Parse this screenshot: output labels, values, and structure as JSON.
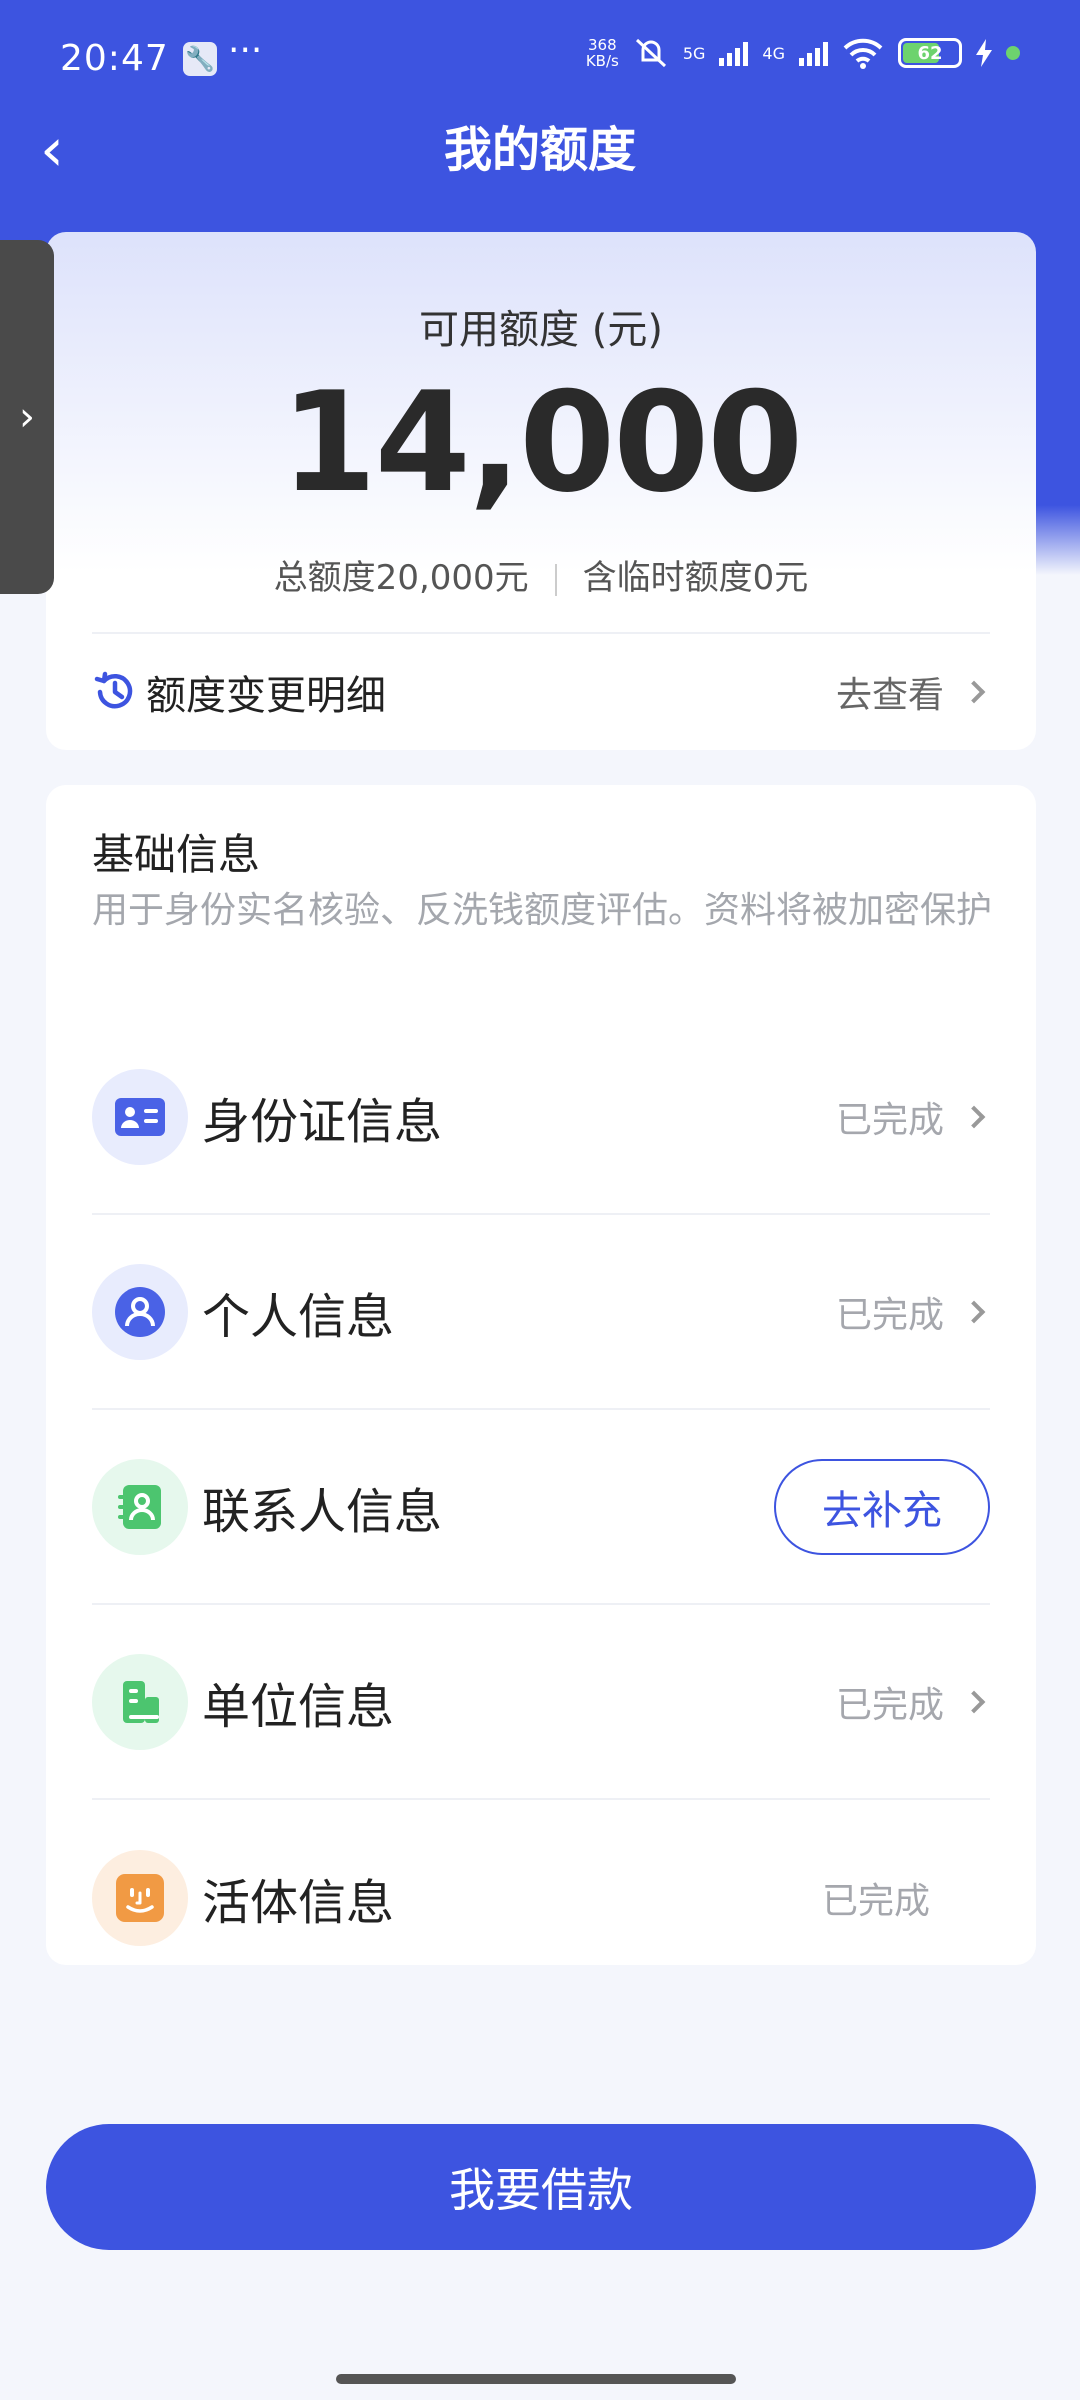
{
  "status_bar": {
    "time": "20:47",
    "more": "···",
    "net_speed_value": "368",
    "net_speed_unit": "KB/s",
    "sim1": "5G",
    "sim2": "4G",
    "battery": "62"
  },
  "header": {
    "back": "‹",
    "title": "我的额度"
  },
  "side_tab": {
    "arrow": "›"
  },
  "credit": {
    "available_label": "可用额度 (元)",
    "available_amount": "14,000",
    "total_limit": "总额度20,000元",
    "temp_limit": "含临时额度0元",
    "history_label": "额度变更明细",
    "history_link": "去查看"
  },
  "basic_info": {
    "title": "基础信息",
    "description": "用于身份实名核验、反洗钱额度评估。资料将被加密保护",
    "items": [
      {
        "label": "身份证信息",
        "status": "已完成",
        "icon": "id-card-icon"
      },
      {
        "label": "个人信息",
        "status": "已完成",
        "icon": "person-icon"
      },
      {
        "label": "联系人信息",
        "action": "去补充",
        "icon": "contact-icon"
      },
      {
        "label": "单位信息",
        "status": "已完成",
        "icon": "building-icon"
      },
      {
        "label": "活体信息",
        "status": "已完成",
        "icon": "face-icon"
      }
    ]
  },
  "borrow_button": "我要借款",
  "colors": {
    "primary": "#3d54e0",
    "background": "#f4f6fc",
    "green": "#4cc56f",
    "orange": "#f19a44"
  }
}
